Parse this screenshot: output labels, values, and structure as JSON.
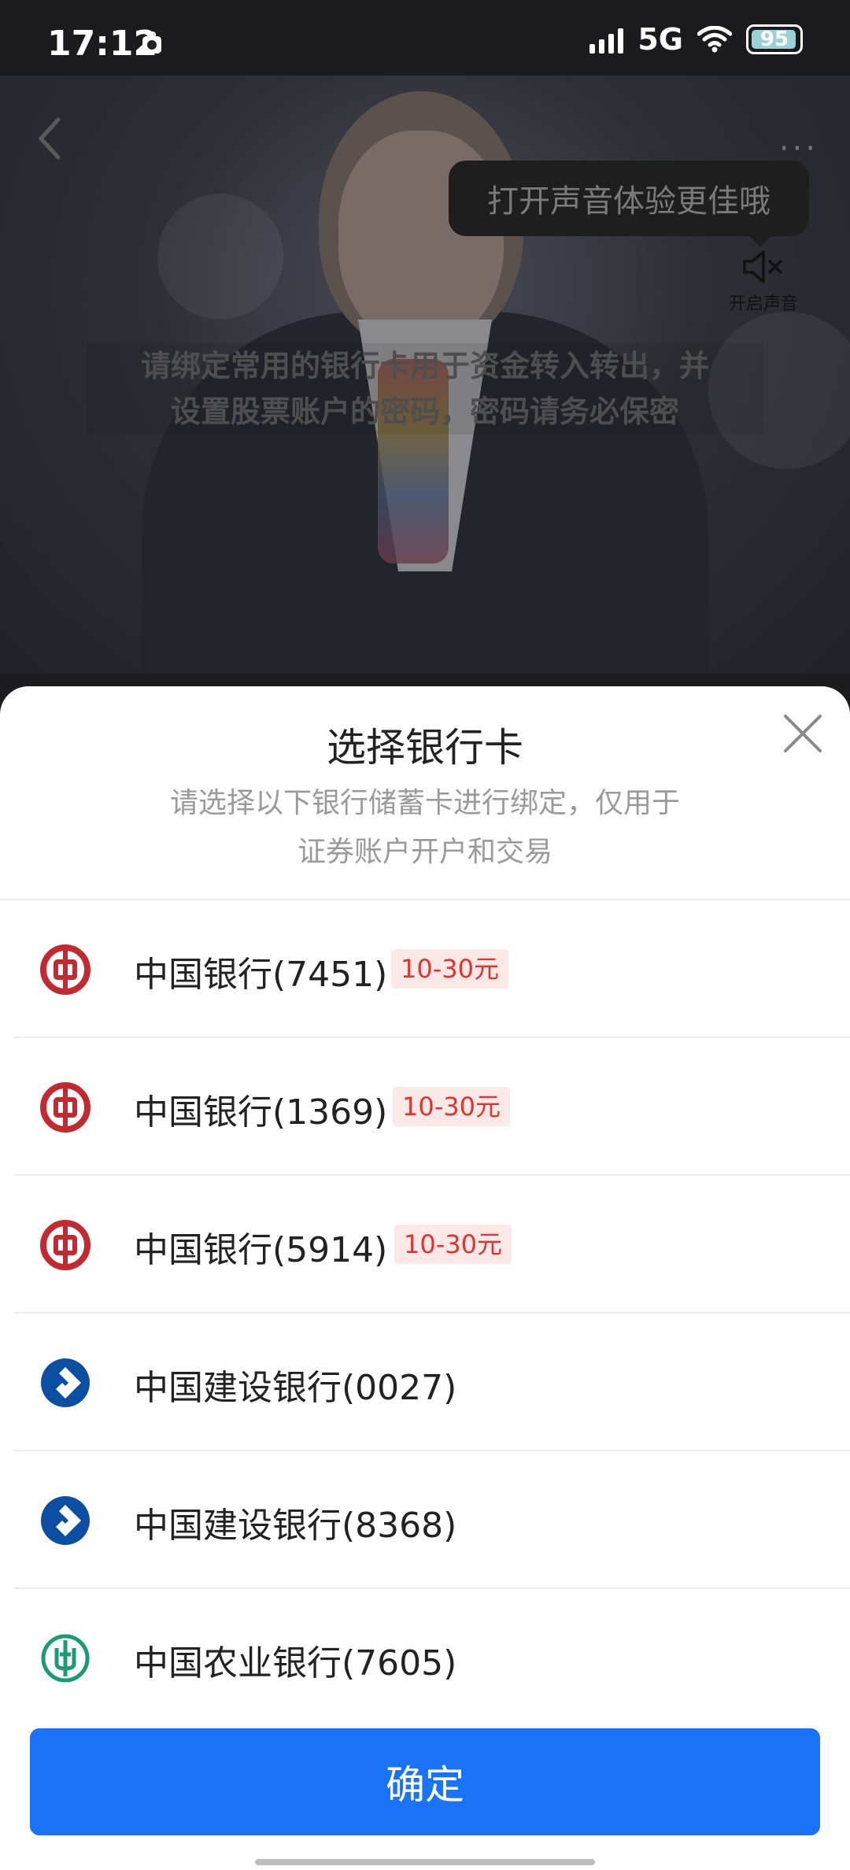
{
  "status_bar": {
    "time": "17:12",
    "network": "5G",
    "battery": "95"
  },
  "video": {
    "sound_tip": "打开声音体验更佳哦",
    "sound_label": "开启声音",
    "subtitle_line1": "请绑定常用的银行卡用于资金转入转出，并",
    "subtitle_line2": "设置股票账户的密码，密码请务必保密",
    "more_label": "···"
  },
  "sheet": {
    "title": "选择银行卡",
    "desc_line1": "请选择以下银行储蓄卡进行绑定，仅用于",
    "desc_line2": "证券账户开户和交易",
    "confirm": "确定"
  },
  "banks": [
    {
      "name": "中国银行(7451)",
      "badge": "10-30元",
      "logo": "boc-icon",
      "color": "#c32a2f"
    },
    {
      "name": "中国银行(1369)",
      "badge": "10-30元",
      "logo": "boc-icon",
      "color": "#c32a2f"
    },
    {
      "name": "中国银行(5914)",
      "badge": "10-30元",
      "logo": "boc-icon",
      "color": "#c32a2f"
    },
    {
      "name": "中国建设银行(0027)",
      "badge": "",
      "logo": "ccb-icon",
      "color": "#0b4ea2"
    },
    {
      "name": "中国建设银行(8368)",
      "badge": "",
      "logo": "ccb-icon",
      "color": "#0b4ea2"
    },
    {
      "name": "中国农业银行(7605)",
      "badge": "",
      "logo": "abc-icon",
      "color": "#1a9b73"
    }
  ],
  "colors": {
    "primary": "#1a73f6",
    "badge_text": "#e0342c",
    "badge_bg": "#fde8e8"
  }
}
